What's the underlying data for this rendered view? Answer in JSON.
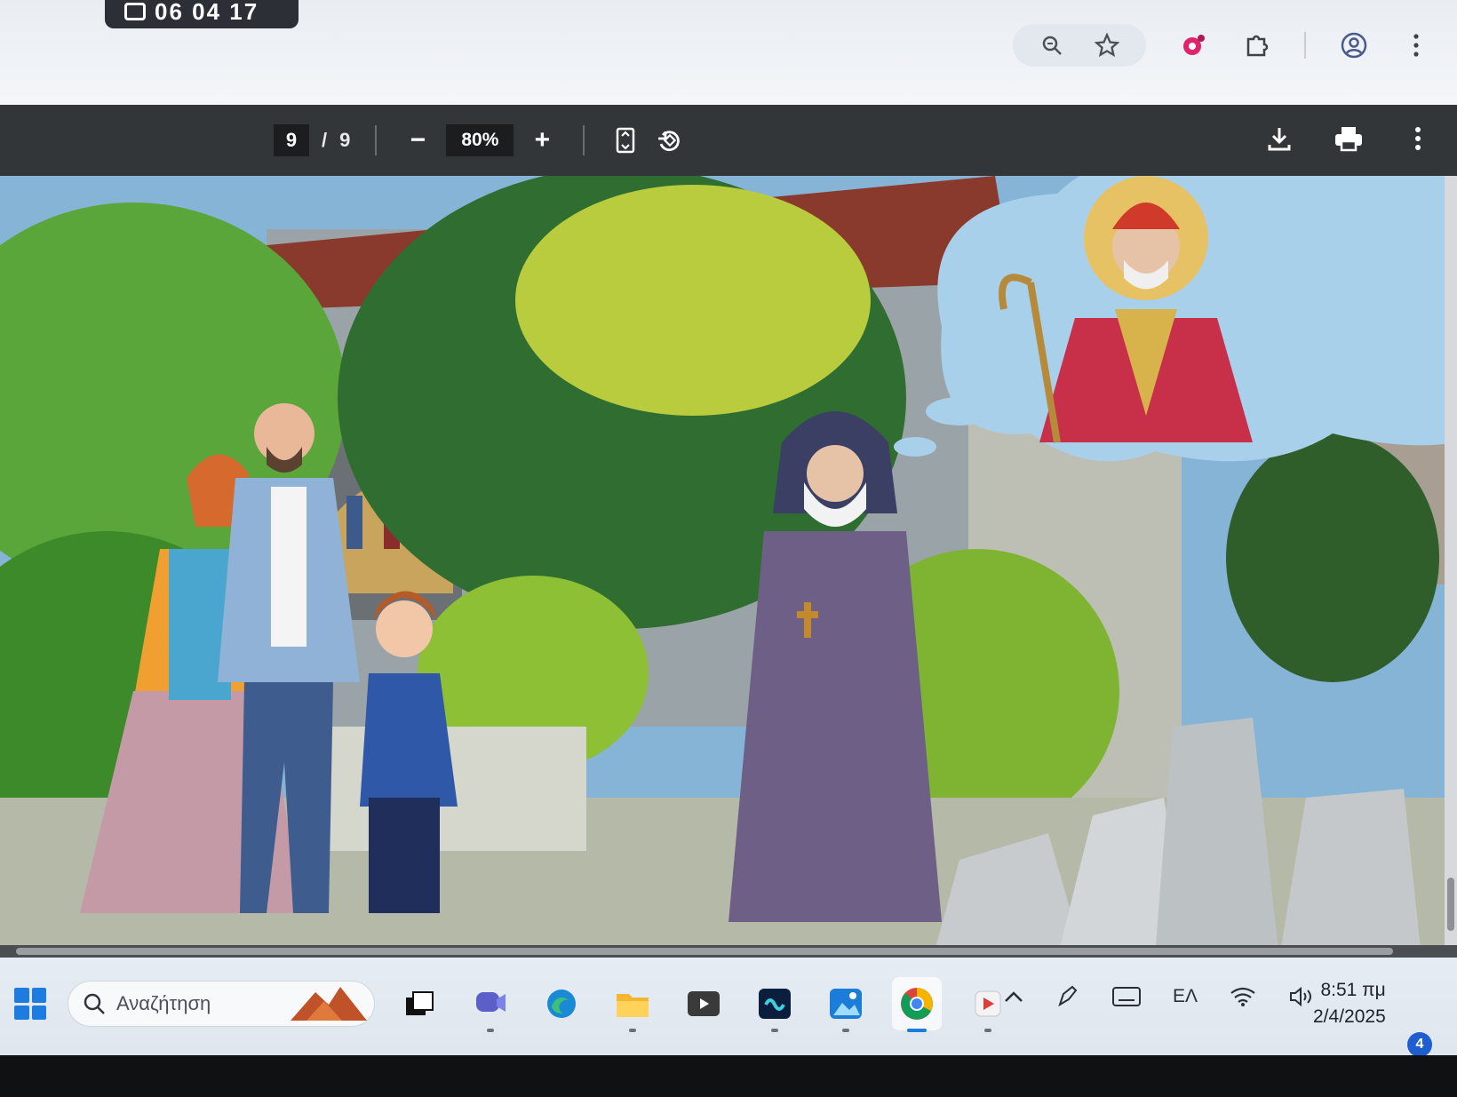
{
  "recorder": {
    "time": "06 04 17"
  },
  "browser": {
    "icons": [
      "zoom-icon",
      "star-icon",
      "extension-colorful-icon",
      "puzzle-icon",
      "profile-icon",
      "more-vert-icon"
    ]
  },
  "pdf_toolbar": {
    "current_page": "9",
    "separator": "/",
    "total_pages": "9",
    "zoom_out": "−",
    "zoom_level": "80%",
    "zoom_in": "+"
  },
  "taskbar": {
    "search_placeholder": "Αναζήτηση",
    "language": "ΕΛ",
    "time": "8:51 πμ",
    "date": "2/4/2025",
    "notification_count": "4"
  },
  "colors": {
    "pdf_toolbar_bg": "#323639",
    "taskbar_bg": "#e3e9f0",
    "accent": "#1e7be0"
  }
}
